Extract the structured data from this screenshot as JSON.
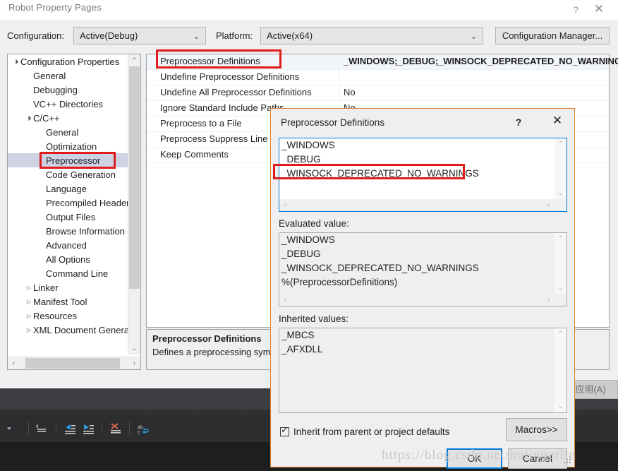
{
  "window": {
    "title": "Robot Property Pages",
    "help_icon": "?",
    "close_icon": "✕"
  },
  "config_bar": {
    "configuration_label": "Configuration:",
    "configuration_value": "Active(Debug)",
    "platform_label": "Platform:",
    "platform_value": "Active(x64)",
    "configuration_manager_button": "Configuration Manager..."
  },
  "tree": {
    "nodes": [
      {
        "label": "Configuration Properties",
        "indent": 0,
        "twisty": "▲",
        "selected": false
      },
      {
        "label": "General",
        "indent": 1,
        "twisty": "",
        "selected": false
      },
      {
        "label": "Debugging",
        "indent": 1,
        "twisty": "",
        "selected": false
      },
      {
        "label": "VC++ Directories",
        "indent": 1,
        "twisty": "",
        "selected": false
      },
      {
        "label": "C/C++",
        "indent": 1,
        "twisty": "▲",
        "selected": false
      },
      {
        "label": "General",
        "indent": 2,
        "twisty": "",
        "selected": false
      },
      {
        "label": "Optimization",
        "indent": 2,
        "twisty": "",
        "selected": false
      },
      {
        "label": "Preprocessor",
        "indent": 2,
        "twisty": "",
        "selected": true
      },
      {
        "label": "Code Generation",
        "indent": 2,
        "twisty": "",
        "selected": false
      },
      {
        "label": "Language",
        "indent": 2,
        "twisty": "",
        "selected": false
      },
      {
        "label": "Precompiled Headers",
        "indent": 2,
        "twisty": "",
        "selected": false
      },
      {
        "label": "Output Files",
        "indent": 2,
        "twisty": "",
        "selected": false
      },
      {
        "label": "Browse Information",
        "indent": 2,
        "twisty": "",
        "selected": false
      },
      {
        "label": "Advanced",
        "indent": 2,
        "twisty": "",
        "selected": false
      },
      {
        "label": "All Options",
        "indent": 2,
        "twisty": "",
        "selected": false
      },
      {
        "label": "Command Line",
        "indent": 2,
        "twisty": "",
        "selected": false
      },
      {
        "label": "Linker",
        "indent": 1,
        "twisty": "▶",
        "selected": false
      },
      {
        "label": "Manifest Tool",
        "indent": 1,
        "twisty": "▶",
        "selected": false
      },
      {
        "label": "Resources",
        "indent": 1,
        "twisty": "▶",
        "selected": false
      },
      {
        "label": "XML Document Generator",
        "indent": 1,
        "twisty": "▶",
        "selected": false
      }
    ]
  },
  "grid": {
    "rows": [
      {
        "name": "Preprocessor Definitions",
        "value": "_WINDOWS;_DEBUG;_WINSOCK_DEPRECATED_NO_WARNINGS",
        "bold": true
      },
      {
        "name": "Undefine Preprocessor Definitions",
        "value": "",
        "bold": false
      },
      {
        "name": "Undefine All Preprocessor Definitions",
        "value": "No",
        "bold": false
      },
      {
        "name": "Ignore Standard Include Paths",
        "value": "No",
        "bold": false
      },
      {
        "name": "Preprocess to a File",
        "value": "",
        "bold": false
      },
      {
        "name": "Preprocess Suppress Line Numbers",
        "value": "",
        "bold": false
      },
      {
        "name": "Keep Comments",
        "value": "",
        "bold": false
      }
    ]
  },
  "description": {
    "title": "Preprocessor Definitions",
    "text": "Defines a preprocessing symbols for your source file."
  },
  "apply_button": "应用(A)",
  "dialog": {
    "title": "Preprocessor Definitions",
    "help_icon": "?",
    "close_icon": "✕",
    "definitions_lines": [
      "_WINDOWS",
      "_DEBUG",
      "_WINSOCK_DEPRECATED_NO_WARNINGS"
    ],
    "evaluated_label": "Evaluated value:",
    "evaluated_lines": [
      "_WINDOWS",
      "_DEBUG",
      "_WINSOCK_DEPRECATED_NO_WARNINGS",
      "%(PreprocessorDefinitions)"
    ],
    "inherited_label": "Inherited values:",
    "inherited_lines": [
      "_MBCS",
      "_AFXDLL"
    ],
    "inherit_checkbox_label": "Inherit from parent or project defaults",
    "inherit_checked": true,
    "macros_button": "Macros>>",
    "ok_button": "OK",
    "cancel_button": "Cancel"
  },
  "watermark": "https://blog.csdn.net/hulingerlin",
  "annotations": {
    "accent_orange": "#e0822a",
    "highlight_red": "#e01b1b",
    "selection_blue": "#0078d7"
  },
  "scroll_arrows": {
    "up": "⌃",
    "down": "⌄",
    "left": "‹",
    "right": "›"
  }
}
